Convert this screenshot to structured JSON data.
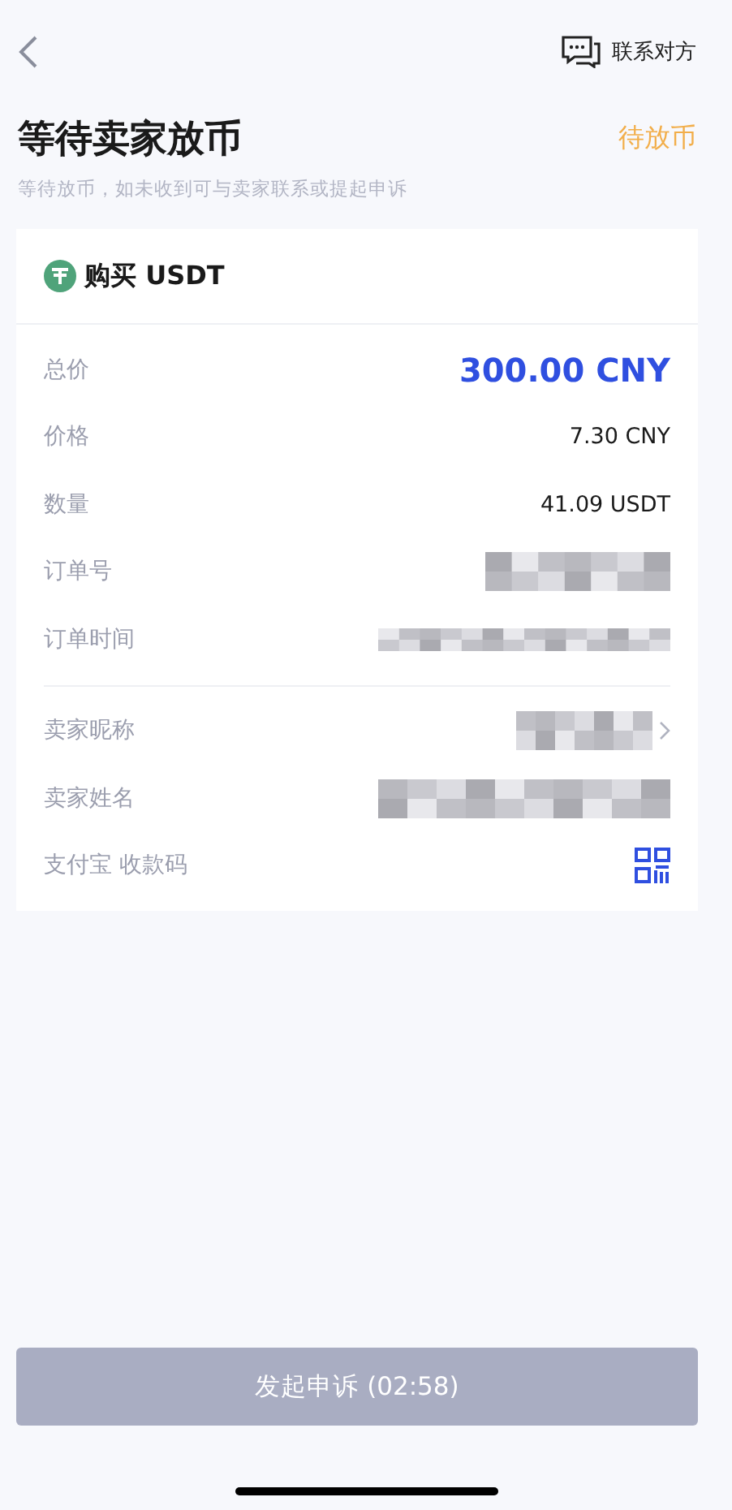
{
  "top_bar": {
    "contact_label": "联系对方"
  },
  "header": {
    "title": "等待卖家放币",
    "status": "待放币",
    "subtitle": "等待放币，如未收到可与卖家联系或提起申诉"
  },
  "order": {
    "heading": "购买 USDT",
    "sections": [
      [
        {
          "kind": "total",
          "label": "总价",
          "value": "300.00 CNY"
        },
        {
          "kind": "text",
          "label": "价格",
          "value": "7.30 CNY"
        },
        {
          "kind": "text",
          "label": "数量",
          "value": "41.09 USDT"
        },
        {
          "kind": "redacted",
          "label": "订单号"
        },
        {
          "kind": "redacted",
          "label": "订单时间"
        }
      ],
      [
        {
          "kind": "redacted-link",
          "label": "卖家昵称"
        },
        {
          "kind": "redacted",
          "label": "卖家姓名"
        },
        {
          "kind": "qr",
          "label": "支付宝 收款码"
        }
      ]
    ]
  },
  "appeal_button": {
    "label": "发起申诉 (02:58)",
    "disabled": true
  }
}
